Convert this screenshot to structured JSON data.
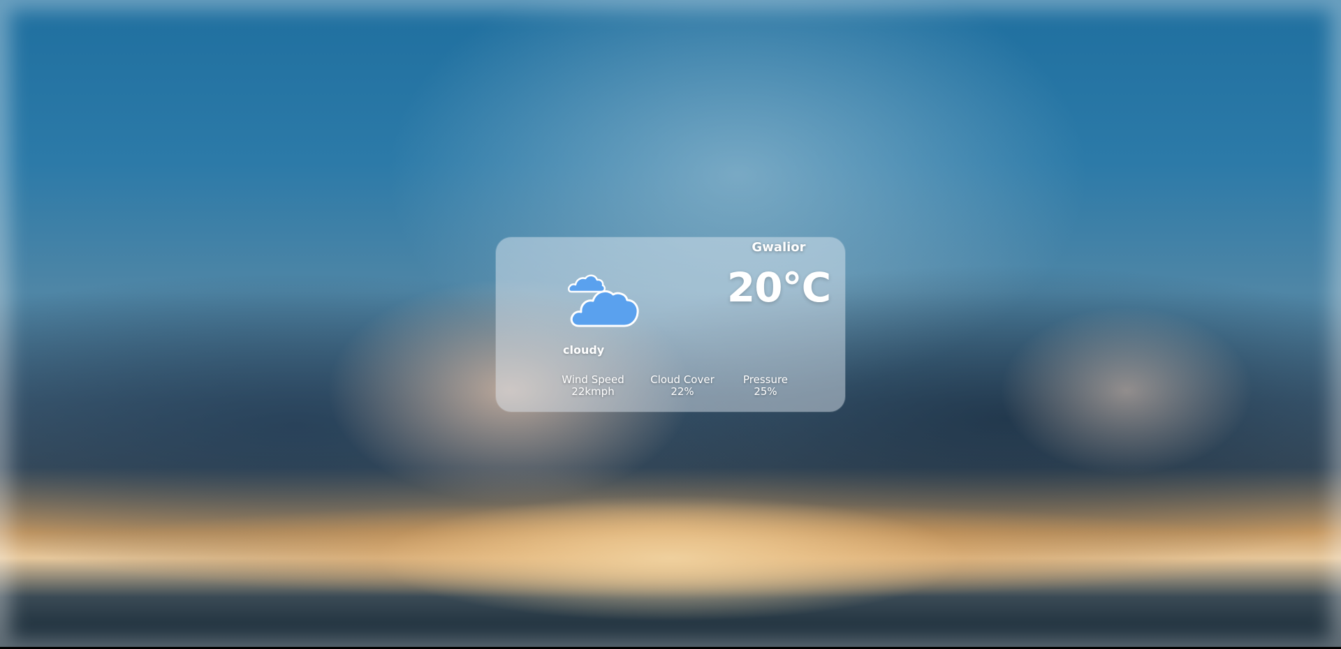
{
  "weather": {
    "city": "Gwalior",
    "temperature": "20°C",
    "condition": "cloudy",
    "icon": "cloudy-icon",
    "stats": {
      "wind_speed": {
        "label": "Wind Speed",
        "value": "22kmph"
      },
      "cloud_cover": {
        "label": "Cloud Cover",
        "value": "22%"
      },
      "pressure": {
        "label": "Pressure",
        "value": "25%"
      }
    }
  },
  "colors": {
    "cloud_fill": "#5aa1ee",
    "cloud_outline": "#ffffff",
    "text": "#ffffff"
  }
}
